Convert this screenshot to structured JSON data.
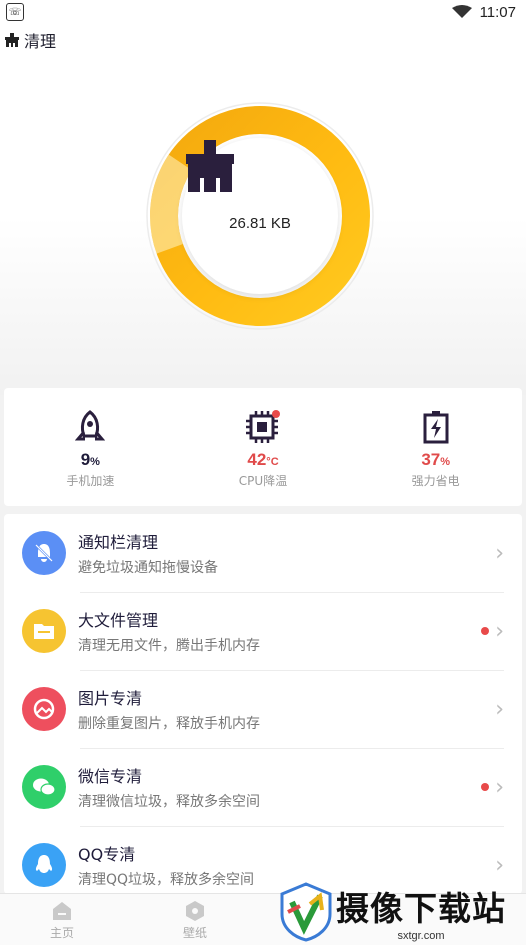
{
  "status_bar": {
    "time": "11:07"
  },
  "header": {
    "title": "清理"
  },
  "cleaner": {
    "size": "26.81 KB"
  },
  "stats": [
    {
      "value": "9",
      "unit": "%",
      "label": "手机加速",
      "icon": "rocket-icon"
    },
    {
      "value": "42",
      "unit": "°C",
      "label": "CPU降温",
      "icon": "chip-icon"
    },
    {
      "value": "37",
      "unit": "%",
      "label": "强力省电",
      "icon": "battery-icon"
    }
  ],
  "features": [
    {
      "title": "通知栏清理",
      "subtitle": "避免垃圾通知拖慢设备",
      "icon": "bell-off-icon",
      "color": "#5b8ff5",
      "badge": false
    },
    {
      "title": "大文件管理",
      "subtitle": "清理无用文件，腾出手机内存",
      "icon": "folder-icon",
      "color": "#f6c431",
      "badge": true
    },
    {
      "title": "图片专清",
      "subtitle": "删除重复图片，释放手机内存",
      "icon": "image-icon",
      "color": "#ee4f5e",
      "badge": false
    },
    {
      "title": "微信专清",
      "subtitle": "清理微信垃圾，释放多余空间",
      "icon": "wechat-icon",
      "color": "#2fcf6a",
      "badge": true
    },
    {
      "title": "QQ专清",
      "subtitle": "清理QQ垃圾，释放多余空间",
      "icon": "qq-icon",
      "color": "#3aa2f5",
      "badge": false
    }
  ],
  "bottom_nav": [
    {
      "label": "主页",
      "icon": "home-icon"
    },
    {
      "label": "壁纸",
      "icon": "wallpaper-icon"
    }
  ],
  "watermark": {
    "text": "摄像下载站",
    "url": "sxtgr.com"
  },
  "colors": {
    "ring_start": "#ffc21a",
    "ring_end": "#f59f0c",
    "accent_dark": "#2a1f3d",
    "alert_red": "#e04a4a"
  }
}
